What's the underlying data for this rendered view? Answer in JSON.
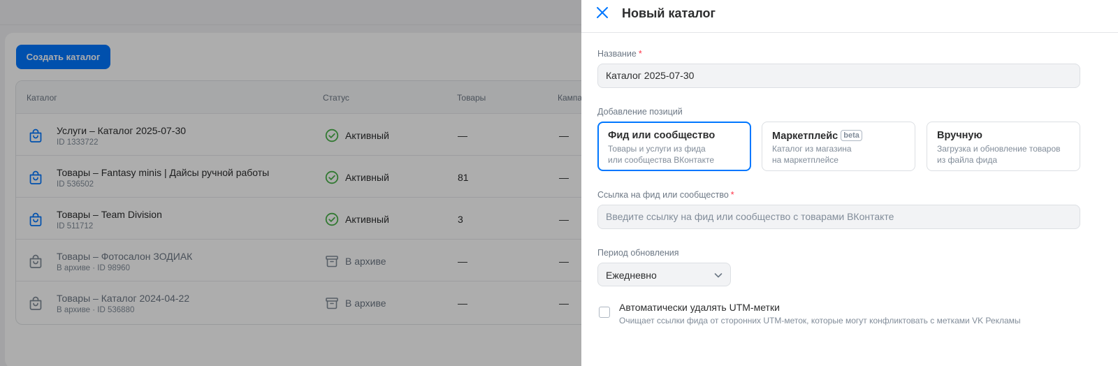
{
  "colors": {
    "accent": "#0077ff",
    "success": "#4bb34b",
    "required": "#ff3347",
    "muted_icon": "#818c99"
  },
  "page": {
    "create_button": "Создать каталог",
    "columns": {
      "catalog": "Каталог",
      "status": "Статус",
      "goods": "Товары",
      "campaigns": "Кампа"
    },
    "rows": [
      {
        "name": "Услуги – Каталог 2025-07-30",
        "sub": "ID 1333722",
        "status": "Активный",
        "status_icon": "check-circle-icon",
        "goods": "—",
        "campaigns": "—",
        "archived": false
      },
      {
        "name": "Товары – Fantasy minis | Дайсы ручной работы",
        "sub": "ID 536502",
        "status": "Активный",
        "status_icon": "check-circle-icon",
        "goods": "81",
        "campaigns": "—",
        "archived": false
      },
      {
        "name": "Товары – Team Division",
        "sub": "ID 511712",
        "status": "Активный",
        "status_icon": "check-circle-icon",
        "goods": "3",
        "campaigns": "—",
        "archived": false
      },
      {
        "name": "Товары – Фотосалон ЗОДИАК",
        "sub": "В архиве · ID 98960",
        "status": "В архиве",
        "status_icon": "archive-box-icon",
        "goods": "—",
        "campaigns": "—",
        "archived": true
      },
      {
        "name": "Товары – Каталог 2024-04-22",
        "sub": "В архиве · ID 536880",
        "status": "В архиве",
        "status_icon": "archive-box-icon",
        "goods": "—",
        "campaigns": "—",
        "archived": true
      }
    ]
  },
  "drawer": {
    "title": "Новый каталог",
    "name_label": "Название",
    "name_value": "Каталог 2025-07-30",
    "positions_label": "Добавление позиций",
    "options": [
      {
        "title": "Фид или сообщество",
        "desc1": "Товары и услуги из фида",
        "desc2": "или сообщества ВКонтакте",
        "selected": true
      },
      {
        "title": "Маркетплейс",
        "badge": "beta",
        "desc1": "Каталог из магазина",
        "desc2": "на маркетплейсе",
        "selected": false
      },
      {
        "title": "Вручную",
        "desc1": "Загрузка и обновление товаров",
        "desc2": "из файла фида",
        "selected": false
      }
    ],
    "feed_label": "Ссылка на фид или сообщество",
    "feed_placeholder": "Введите ссылку на фид или сообщество с товарами ВКонтакте",
    "period_label": "Период обновления",
    "period_value": "Ежедневно",
    "utm_title": "Автоматически удалять UTM-метки",
    "utm_desc": "Очищает ссылки фида от сторонних UTM-меток, которые могут конфликтовать с метками VK Рекламы"
  }
}
